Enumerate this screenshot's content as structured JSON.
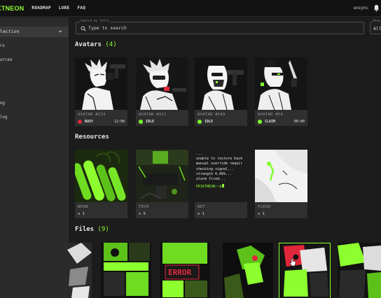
{
  "nav": {
    "logo": "JKTNEON",
    "links": [
      "ROADMAP",
      "LORE",
      "FAQ"
    ],
    "status": "unsync"
  },
  "sidebar": {
    "header": "llection",
    "items": [
      "ars",
      "ources",
      "s",
      "s",
      "ing",
      "elog"
    ]
  },
  "search": {
    "label": "Search by title",
    "placeholder": "Type to search",
    "show_label": "Show",
    "show_value": "All"
  },
  "sections": {
    "avatars": {
      "title": "Avatars",
      "count": "(4)"
    },
    "resources": {
      "title": "Resources"
    },
    "files": {
      "title": "Files",
      "count": "(9)"
    }
  },
  "avatars": [
    {
      "name": "AVATAR #233",
      "status": "BUSY",
      "time": "12:00",
      "color": "#e0283a"
    },
    {
      "name": "AVATAR #311",
      "status": "IDLE",
      "time": "",
      "color": "#7dff2a"
    },
    {
      "name": "AVATAR #549",
      "status": "IDLE",
      "time": "",
      "color": "#7dff2a"
    },
    {
      "name": "AVATAR #54",
      "status": "CLAIM",
      "time": "00:00",
      "color": "#7dff2a"
    }
  ],
  "resources": [
    {
      "name": "NEON",
      "qty": "x 1"
    },
    {
      "name": "TECH",
      "qty": "x 5"
    },
    {
      "name": "NET",
      "qty": "x 1"
    },
    {
      "name": "FLESH",
      "qty": "x 1"
    }
  ],
  "terminal": {
    "lines": [
      "...",
      "unable to restore back",
      "manual override requir",
      "checking signal...",
      "strength 6.66%...",
      "alarm fired..."
    ],
    "prompt": "PR1KTNEON:~$"
  },
  "files_art": {
    "error_text": "ERROR"
  },
  "colors": {
    "accent": "#8dff2e",
    "busy": "#e0283a",
    "idle": "#7dff2a"
  }
}
